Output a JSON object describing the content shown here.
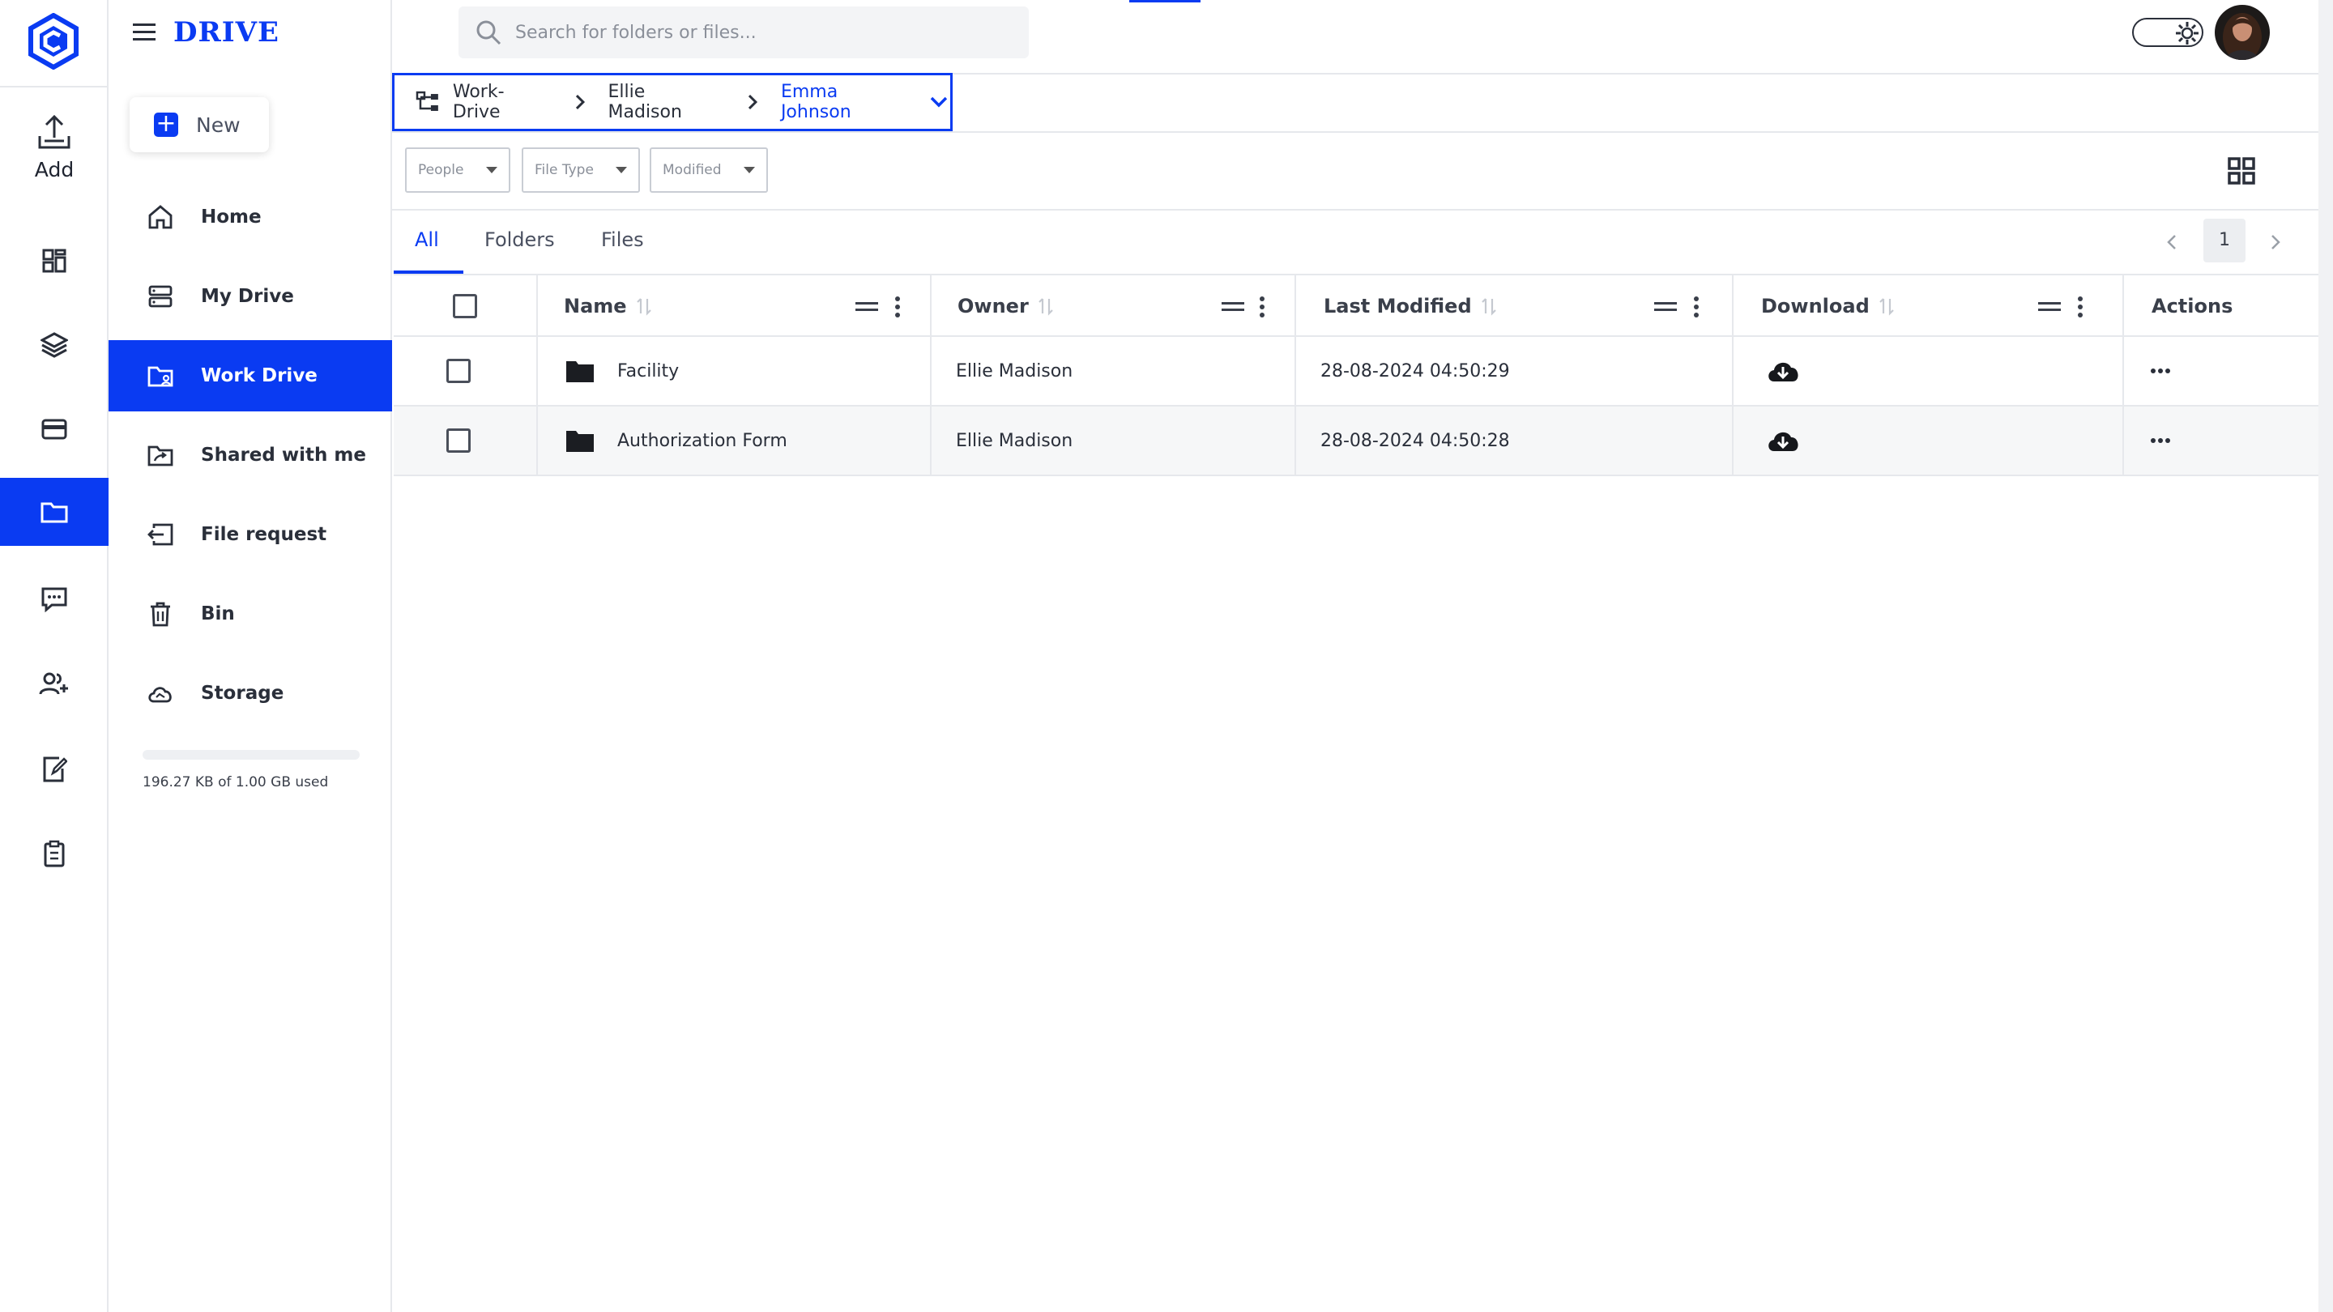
{
  "app": {
    "title": "DRIVE",
    "accent": "#0a3bf2"
  },
  "rail": {
    "add_label": "Add",
    "items": [
      "dashboard-icon",
      "layers-icon",
      "card-icon",
      "folder-icon",
      "chat-icon",
      "users-icon",
      "edit-doc-icon",
      "clipboard-icon"
    ],
    "active": "folder-icon"
  },
  "sidebar": {
    "new_label": "New",
    "items": [
      {
        "label": "Home",
        "icon": "home-icon"
      },
      {
        "label": "My Drive",
        "icon": "drive-icon"
      },
      {
        "label": "Work Drive",
        "icon": "work-folder-icon",
        "active": true
      },
      {
        "label": "Shared with me",
        "icon": "shared-folder-icon"
      },
      {
        "label": "File request",
        "icon": "file-request-icon"
      },
      {
        "label": "Bin",
        "icon": "bin-icon"
      },
      {
        "label": "Storage",
        "icon": "cloud-icon"
      }
    ],
    "storage_text": "196.27 KB of 1.00 GB used",
    "storage_used_fraction": 0.0002
  },
  "search": {
    "placeholder": "Search for folders or files..."
  },
  "breadcrumb": {
    "items": [
      "Work-Drive",
      "Ellie Madison",
      "Emma Johnson"
    ]
  },
  "filters": {
    "people": "People",
    "file_type": "File Type",
    "modified": "Modified"
  },
  "tabs": [
    "All",
    "Folders",
    "Files"
  ],
  "active_tab": "All",
  "pager": {
    "page": "1"
  },
  "table": {
    "columns": [
      "Name",
      "Owner",
      "Last Modified",
      "Download",
      "Actions"
    ],
    "rows": [
      {
        "name": "Facility",
        "owner": "Ellie Madison",
        "modified": "28-08-2024 04:50:29"
      },
      {
        "name": "Authorization Form",
        "owner": "Ellie Madison",
        "modified": "28-08-2024 04:50:28"
      }
    ]
  }
}
